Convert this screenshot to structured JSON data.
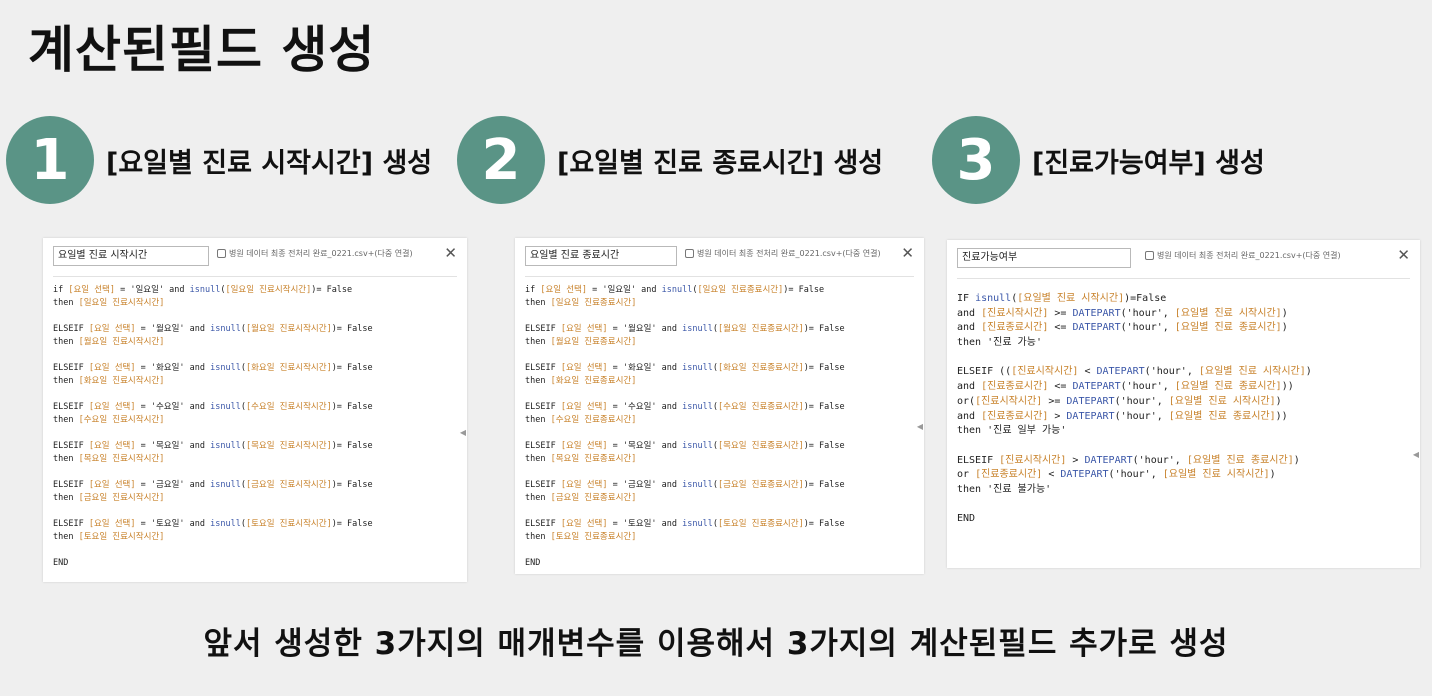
{
  "page": {
    "title": "계산된필드 생성",
    "footer": "앞서 생성한 3가지의 매개변수를 이용해서 3가지의 계산된필드 추가로 생성"
  },
  "steps": [
    {
      "number": "1",
      "label": "[요일별 진료 시작시간] 생성"
    },
    {
      "number": "2",
      "label": "[요일별 진료 종료시간] 생성"
    },
    {
      "number": "3",
      "label": "[진료가능여부] 생성"
    }
  ],
  "colors": {
    "accent": "#5a9486",
    "function": "#3b57a8",
    "field": "#c8822b"
  },
  "panels": [
    {
      "name": "요일별 진료 시작시간",
      "source": "병원 데이터 최종 전처리 완료_0221.csv+(다중 연결)",
      "close_icon": "✕",
      "lines": [
        [
          "if ",
          {
            "f": "[요일 선택]"
          },
          " = '일요일' and ",
          {
            "fn": "isnull"
          },
          "(",
          {
            "f": "[일요일 진료시작시간]"
          },
          ")= False"
        ],
        [
          "then ",
          {
            "f": "[일요일 진료시작시간]"
          }
        ],
        [
          ""
        ],
        [
          "ELSEIF ",
          {
            "f": "[요일 선택]"
          },
          " = '월요일' and ",
          {
            "fn": "isnull"
          },
          "(",
          {
            "f": "[월요일 진료시작시간]"
          },
          ")= False"
        ],
        [
          "then ",
          {
            "f": "[월요일 진료시작시간]"
          }
        ],
        [
          ""
        ],
        [
          "ELSEIF ",
          {
            "f": "[요일 선택]"
          },
          " = '화요일' and ",
          {
            "fn": "isnull"
          },
          "(",
          {
            "f": "[화요일 진료시작시간]"
          },
          ")= False"
        ],
        [
          "then ",
          {
            "f": "[화요일 진료시작시간]"
          }
        ],
        [
          ""
        ],
        [
          "ELSEIF ",
          {
            "f": "[요일 선택]"
          },
          " = '수요일' and ",
          {
            "fn": "isnull"
          },
          "(",
          {
            "f": "[수요일 진료시작시간]"
          },
          ")= False"
        ],
        [
          "then ",
          {
            "f": "[수요일 진료시작시간]"
          }
        ],
        [
          ""
        ],
        [
          "ELSEIF ",
          {
            "f": "[요일 선택]"
          },
          " = '목요일' and ",
          {
            "fn": "isnull"
          },
          "(",
          {
            "f": "[목요일 진료시작시간]"
          },
          ")= False"
        ],
        [
          "then ",
          {
            "f": "[목요일 진료시작시간]"
          }
        ],
        [
          ""
        ],
        [
          "ELSEIF ",
          {
            "f": "[요일 선택]"
          },
          " = '금요일' and ",
          {
            "fn": "isnull"
          },
          "(",
          {
            "f": "[금요일 진료시작시간]"
          },
          ")= False"
        ],
        [
          "then ",
          {
            "f": "[금요일 진료시작시간]"
          }
        ],
        [
          ""
        ],
        [
          "ELSEIF ",
          {
            "f": "[요일 선택]"
          },
          " = '토요일' and ",
          {
            "fn": "isnull"
          },
          "(",
          {
            "f": "[토요일 진료시작시간]"
          },
          ")= False"
        ],
        [
          "then ",
          {
            "f": "[토요일 진료시작시간]"
          }
        ],
        [
          ""
        ],
        [
          "END"
        ]
      ]
    },
    {
      "name": "요일별 진료 종료시간",
      "source": "병원 데이터 최종 전처리 완료_0221.csv+(다중 연결)",
      "close_icon": "✕",
      "lines": [
        [
          "if ",
          {
            "f": "[요일 선택]"
          },
          " = '일요일' and ",
          {
            "fn": "isnull"
          },
          "(",
          {
            "f": "[일요일 진료종료시간]"
          },
          ")= False"
        ],
        [
          "then ",
          {
            "f": "[일요일 진료종료시간]"
          }
        ],
        [
          ""
        ],
        [
          "ELSEIF ",
          {
            "f": "[요일 선택]"
          },
          " = '월요일' and ",
          {
            "fn": "isnull"
          },
          "(",
          {
            "f": "[월요일 진료종료시간]"
          },
          ")= False"
        ],
        [
          "then ",
          {
            "f": "[월요일 진료종료시간]"
          }
        ],
        [
          ""
        ],
        [
          "ELSEIF ",
          {
            "f": "[요일 선택]"
          },
          " = '화요일' and ",
          {
            "fn": "isnull"
          },
          "(",
          {
            "f": "[화요일 진료종료시간]"
          },
          ")= False"
        ],
        [
          "then ",
          {
            "f": "[화요일 진료종료시간]"
          }
        ],
        [
          ""
        ],
        [
          "ELSEIF ",
          {
            "f": "[요일 선택]"
          },
          " = '수요일' and ",
          {
            "fn": "isnull"
          },
          "(",
          {
            "f": "[수요일 진료종료시간]"
          },
          ")= False"
        ],
        [
          "then ",
          {
            "f": "[수요일 진료종료시간]"
          }
        ],
        [
          ""
        ],
        [
          "ELSEIF ",
          {
            "f": "[요일 선택]"
          },
          " = '목요일' and ",
          {
            "fn": "isnull"
          },
          "(",
          {
            "f": "[목요일 진료종료시간]"
          },
          ")= False"
        ],
        [
          "then ",
          {
            "f": "[목요일 진료종료시간]"
          }
        ],
        [
          ""
        ],
        [
          "ELSEIF ",
          {
            "f": "[요일 선택]"
          },
          " = '금요일' and ",
          {
            "fn": "isnull"
          },
          "(",
          {
            "f": "[금요일 진료종료시간]"
          },
          ")= False"
        ],
        [
          "then ",
          {
            "f": "[금요일 진료종료시간]"
          }
        ],
        [
          ""
        ],
        [
          "ELSEIF ",
          {
            "f": "[요일 선택]"
          },
          " = '토요일' and ",
          {
            "fn": "isnull"
          },
          "(",
          {
            "f": "[토요일 진료종료시간]"
          },
          ")= False"
        ],
        [
          "then ",
          {
            "f": "[토요일 진료종료시간]"
          }
        ],
        [
          ""
        ],
        [
          "END"
        ]
      ]
    },
    {
      "name": "진료가능여부",
      "source": "병원 데이터 최종 전처리 완료_0221.csv+(다중 연결)",
      "close_icon": "✕",
      "lines": [
        [
          "IF ",
          {
            "fn": "isnull"
          },
          "(",
          {
            "f": "[요일별 진료 시작시간]"
          },
          ")=False"
        ],
        [
          "and ",
          {
            "f": "[진료시작시간]"
          },
          " >= ",
          {
            "fn": "DATEPART"
          },
          "('hour', ",
          {
            "f": "[요일별 진료 시작시간]"
          },
          ")"
        ],
        [
          "and ",
          {
            "f": "[진료종료시간]"
          },
          " <= ",
          {
            "fn": "DATEPART"
          },
          "('hour', ",
          {
            "f": "[요일별 진료 종료시간]"
          },
          ")"
        ],
        [
          "then '진료 가능'"
        ],
        [
          ""
        ],
        [
          "ELSEIF ((",
          {
            "f": "[진료시작시간]"
          },
          " < ",
          {
            "fn": "DATEPART"
          },
          "('hour', ",
          {
            "f": "[요일별 진료 시작시간]"
          },
          ")"
        ],
        [
          "and ",
          {
            "f": "[진료종료시간]"
          },
          " <= ",
          {
            "fn": "DATEPART"
          },
          "('hour', ",
          {
            "f": "[요일별 진료 종료시간]"
          },
          "))"
        ],
        [
          "or(",
          {
            "f": "[진료시작시간]"
          },
          " >= ",
          {
            "fn": "DATEPART"
          },
          "('hour', ",
          {
            "f": "[요일별 진료 시작시간]"
          },
          ")"
        ],
        [
          "and ",
          {
            "f": "[진료종료시간]"
          },
          " > ",
          {
            "fn": "DATEPART"
          },
          "('hour', ",
          {
            "f": "[요일별 진료 종료시간]"
          },
          "))"
        ],
        [
          "then '진료 일부 가능'"
        ],
        [
          ""
        ],
        [
          "ELSEIF ",
          {
            "f": "[진료시작시간]"
          },
          " > ",
          {
            "fn": "DATEPART"
          },
          "('hour', ",
          {
            "f": "[요일별 진료 종료시간]"
          },
          ")"
        ],
        [
          "or ",
          {
            "f": "[진료종료시간]"
          },
          " < ",
          {
            "fn": "DATEPART"
          },
          "('hour', ",
          {
            "f": "[요일별 진료 시작시간]"
          },
          ")"
        ],
        [
          "then '진료 불가능'"
        ],
        [
          ""
        ],
        [
          "END"
        ]
      ]
    }
  ]
}
